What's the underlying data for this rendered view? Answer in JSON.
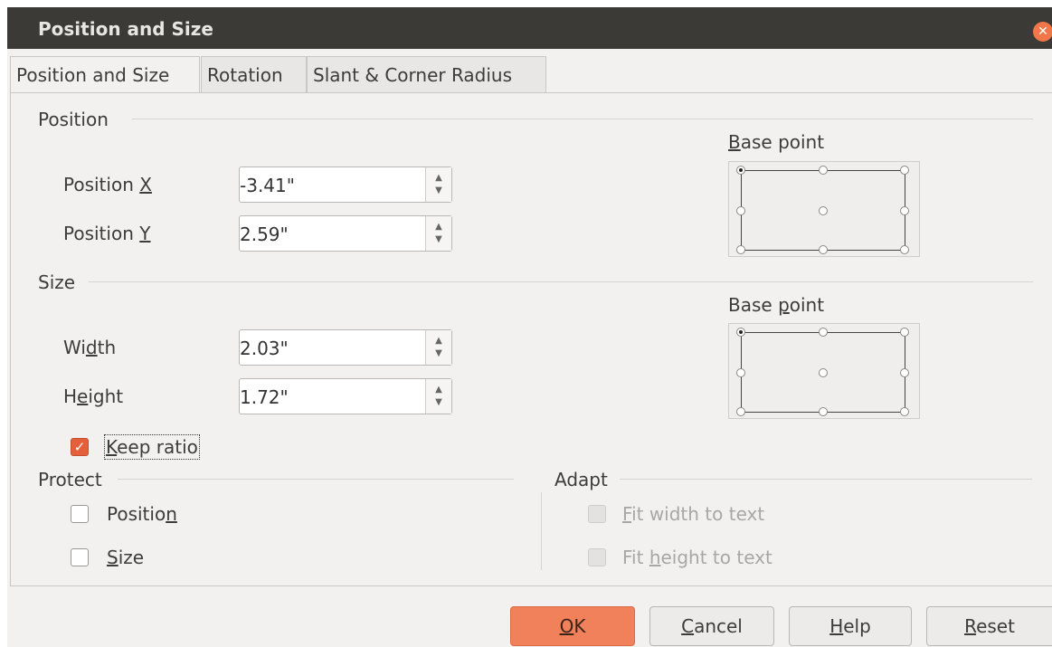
{
  "window": {
    "title": "Position and Size",
    "close_icon": "close-icon",
    "accent": "#f1774a"
  },
  "tabs": [
    {
      "label": "Position and Size",
      "active": true
    },
    {
      "label": "Rotation",
      "active": false
    },
    {
      "label": "Slant & Corner Radius",
      "active": false
    }
  ],
  "position": {
    "heading": "Position",
    "x_label_prefix": "Position ",
    "x_label_key": "X",
    "x_value": "-3.41\"",
    "y_label_prefix": "Position ",
    "y_label_key": "Y",
    "y_value": "2.59\"",
    "base_point_key": "B",
    "base_point_rest": "ase point"
  },
  "size": {
    "heading": "Size",
    "width_pre": "Wi",
    "width_key": "d",
    "width_post": "th",
    "width_value": "2.03\"",
    "height_pre": "H",
    "height_key": "e",
    "height_post": "ight",
    "height_value": "1.72\"",
    "base_point_pre": "Base ",
    "base_point_key": "p",
    "base_point_post": "oint",
    "keep_ratio_key": "K",
    "keep_ratio_rest": "eep ratio",
    "keep_ratio_checked": true
  },
  "protect": {
    "heading": "Protect",
    "position_pre": "Positio",
    "position_key": "n",
    "position_checked": false,
    "size_key": "S",
    "size_rest": "ize",
    "size_checked": false
  },
  "adapt": {
    "heading": "Adapt",
    "fit_width_key": "F",
    "fit_width_rest": "it width to text",
    "fit_height_pre": "Fit ",
    "fit_height_key": "h",
    "fit_height_post": "eight to text"
  },
  "buttons": {
    "ok_key": "O",
    "ok_rest": "K",
    "cancel_key": "C",
    "cancel_rest": "ancel",
    "help_key": "H",
    "help_rest": "elp",
    "reset_key": "R",
    "reset_rest": "eset"
  }
}
